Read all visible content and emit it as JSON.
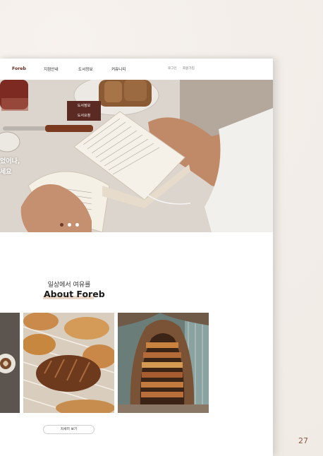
{
  "nav": {
    "logo": "Foreb",
    "menu": [
      "지점안내",
      "도서정보",
      "커뮤니티"
    ],
    "login": "로그인",
    "signup": "회원가입"
  },
  "dropdown": {
    "items": [
      "도서정보",
      "도서요청"
    ]
  },
  "hero": {
    "text_line1": "었어나,",
    "text_line2": "세요",
    "slide_dots": 3,
    "active_dot": 1
  },
  "about": {
    "subtitle": "일상에서 여유를",
    "title": "About Foreb",
    "images": [
      "coffee-cup-image",
      "croissant-image",
      "bookshelf-tree-image"
    ],
    "more_button": "자세히 보기"
  },
  "page_number": "27",
  "colors": {
    "brand": "#6b2a1f",
    "dropdown_bg": "#5b2b23",
    "underline": "#ead7c8",
    "page_number": "#8a5a4a"
  }
}
